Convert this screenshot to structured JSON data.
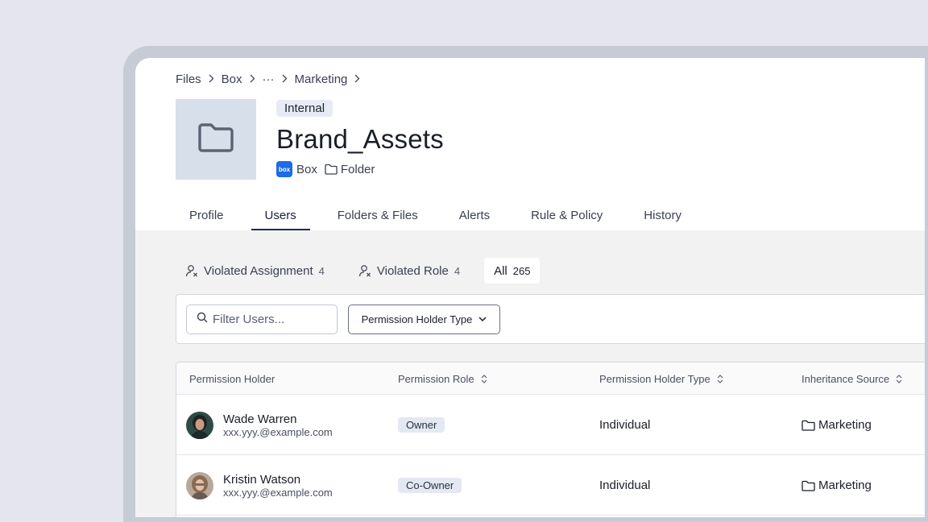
{
  "breadcrumb": {
    "items": [
      "Files",
      "Box",
      "···",
      "Marketing"
    ]
  },
  "asset": {
    "badge": "Internal",
    "title": "Brand_Assets",
    "source_logo_text": "box",
    "source": "Box",
    "kind": "Folder",
    "icon": "folder-icon"
  },
  "tabs": [
    {
      "label": "Profile",
      "active": false
    },
    {
      "label": "Users",
      "active": true
    },
    {
      "label": "Folders & Files",
      "active": false
    },
    {
      "label": "Alerts",
      "active": false
    },
    {
      "label": "Rule & Policy",
      "active": false
    },
    {
      "label": "History",
      "active": false
    }
  ],
  "filters": [
    {
      "label": "Violated Assignment",
      "count": "4",
      "icon": "user-x-icon"
    },
    {
      "label": "Violated Role",
      "count": "4",
      "icon": "user-x-icon"
    },
    {
      "label": "All",
      "count": "265",
      "active": true
    }
  ],
  "toolbar": {
    "search_placeholder": "Filter Users...",
    "dropdown_label": "Permission Holder Type"
  },
  "table": {
    "columns": [
      "Permission Holder",
      "Permission Role",
      "Permission Holder Type",
      "Inheritance Source"
    ],
    "rows": [
      {
        "name": "Wade Warren",
        "email": "xxx.yyy.@example.com",
        "role": "Owner",
        "type": "Individual",
        "source": "Marketing"
      },
      {
        "name": "Kristin Watson",
        "email": "xxx.yyy.@example.com",
        "role": "Co-Owner",
        "type": "Individual",
        "source": "Marketing"
      }
    ]
  },
  "colors": {
    "background": "#e4e5ee",
    "accent": "#1f2a4d",
    "box_blue": "#1c6be8",
    "tile": "#d7dfeb"
  }
}
